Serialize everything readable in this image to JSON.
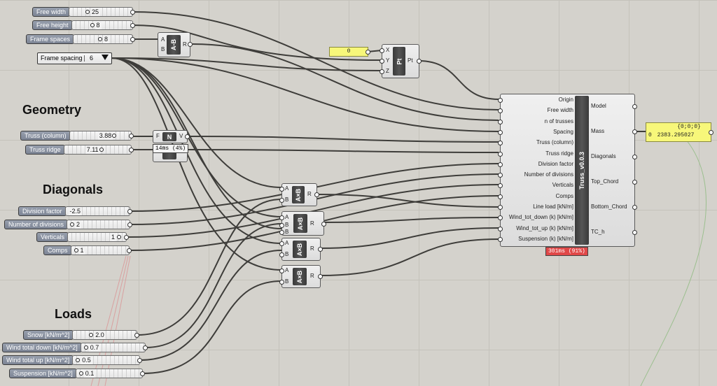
{
  "sliders": {
    "free_width": {
      "label": "Free width",
      "value": "25"
    },
    "free_height": {
      "label": "Free height",
      "value": "8"
    },
    "frame_spaces": {
      "label": "Frame spaces",
      "value": "8"
    },
    "truss_column": {
      "label": "Truss (column)",
      "value": "3.88"
    },
    "truss_ridge": {
      "label": "Truss ridge",
      "value": "7.11"
    },
    "division_factor": {
      "label": "Division factor",
      "value": "-2.5"
    },
    "number_of_divisions": {
      "label": "Number of divisions",
      "value": "2"
    },
    "verticals": {
      "label": "Verticals",
      "value": "1"
    },
    "comps": {
      "label": "Comps",
      "value": "1"
    },
    "snow": {
      "label": "Snow [kN/m^2]",
      "value": "2.0"
    },
    "wind_total_down": {
      "label": "Wind total down [kN/m^2]",
      "value": "0.7"
    },
    "wind_total_up": {
      "label": "Wind total up [kN/m^2]",
      "value": "0.5"
    },
    "suspension": {
      "label": "Suspension [kN/m^2]",
      "value": "0.1"
    }
  },
  "dropdown": {
    "label": "Frame spacing",
    "value": "6"
  },
  "headings": {
    "geometry": "Geometry",
    "diagonals": "Diagonals",
    "loads": "Loads"
  },
  "mult_component": {
    "in_a": "A",
    "in_b": "B",
    "core": "A×B",
    "out": "R"
  },
  "pt_component": {
    "in_x": "X",
    "in_y": "Y",
    "in_z": "Z",
    "core": "Pt",
    "out": "Pt"
  },
  "nv_component": {
    "in_f": "F",
    "out_v": "V",
    "core": "N"
  },
  "panels": {
    "zero": "0",
    "mass_header": "{0;0;0}",
    "mass_index": "0",
    "mass_value": "2383.295027"
  },
  "truss": {
    "title": "Truss_v0.0.3",
    "inputs": [
      "Origin",
      "Free width",
      "n of trusses",
      "Spacing",
      "Truss (column)",
      "Truss ridge",
      "Division factor",
      "Number of divisions",
      "Verticals",
      "Comps",
      "Line load [kN/m]",
      "Wind_tot_down (k) [kN/m]",
      "Wind_tot_up (k) [kN/m]",
      "Suspension (k) [kN/m]"
    ],
    "outputs": [
      "Model",
      "Mass",
      "Diagonals",
      "Top_Chord",
      "Bottom_Chord",
      "TC_h"
    ],
    "timing": "301ms (91%)"
  },
  "tooltip_timing": "14ms (4%)",
  "colors": {
    "canvas": "#d4d2cc",
    "wire": "#3e3d3a",
    "panel": "#f7f77a",
    "timing_badge": "#e04848"
  }
}
